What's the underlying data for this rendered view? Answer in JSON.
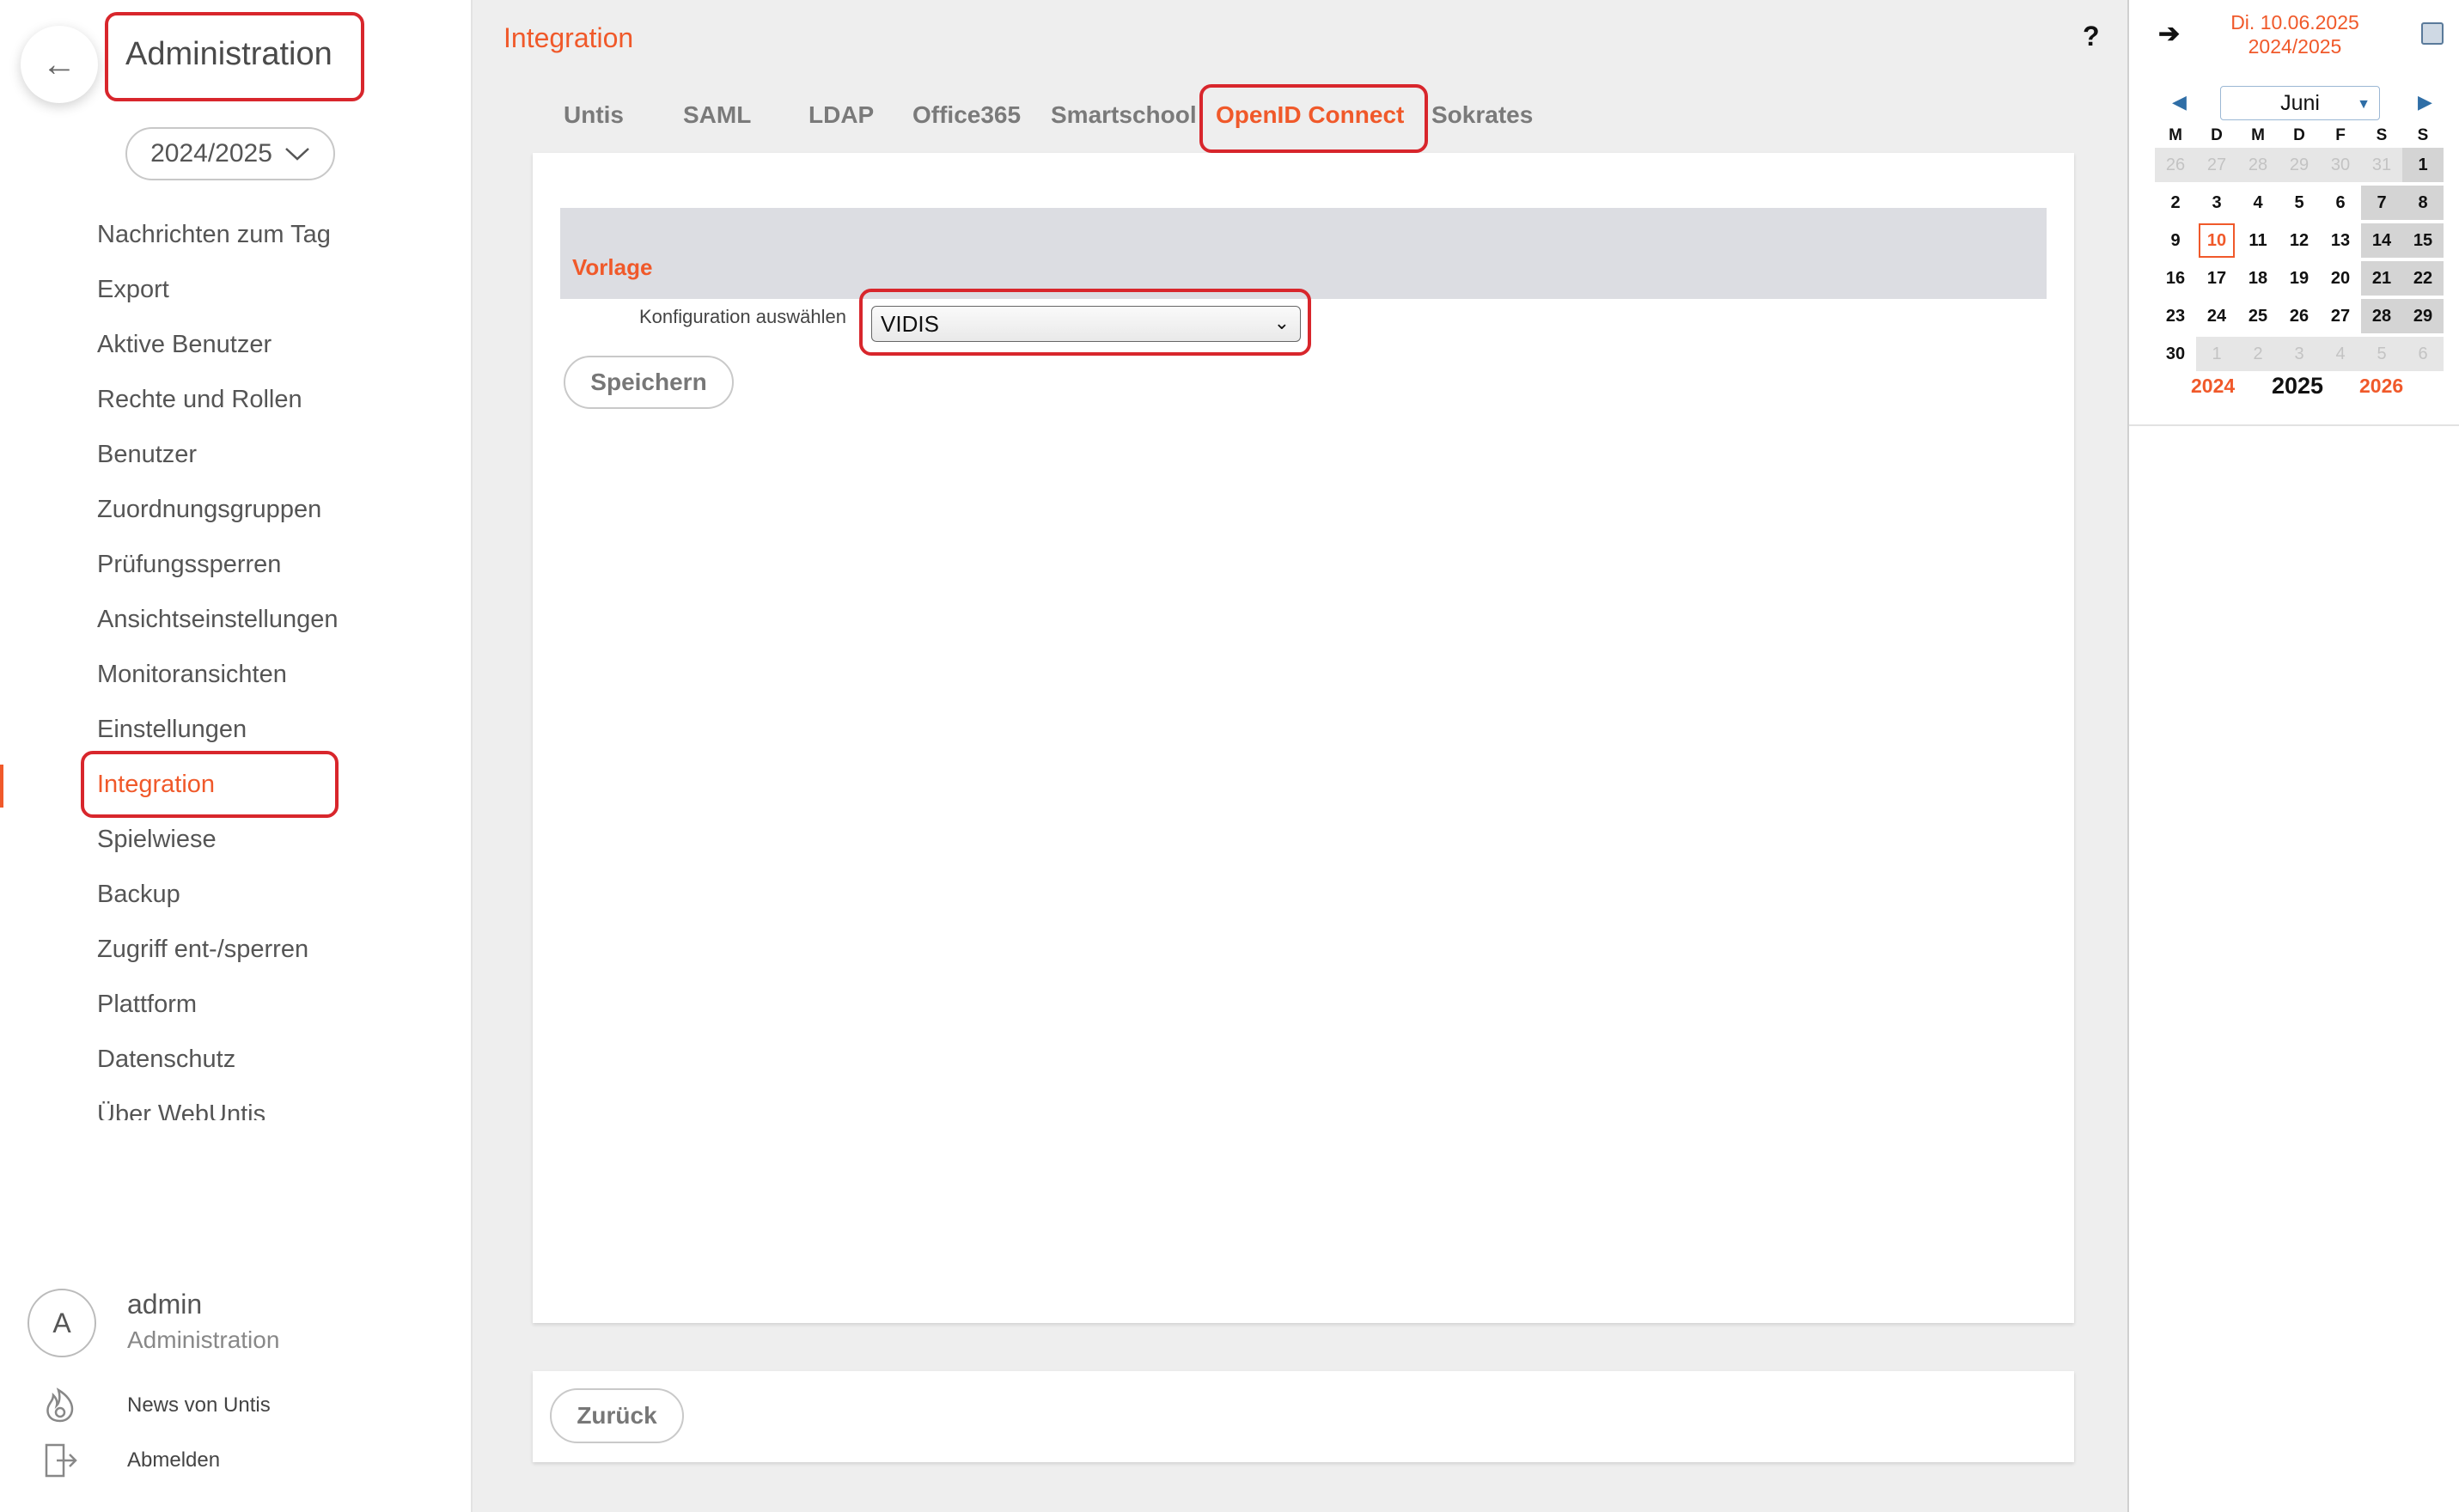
{
  "sidebar": {
    "back_icon": "arrow-left-icon",
    "title": "Administration",
    "school_year": "2024/2025",
    "nav_items": [
      "Nachrichten zum Tag",
      "Export",
      "Aktive Benutzer",
      "Rechte und Rollen",
      "Benutzer",
      "Zuordnungsgruppen",
      "Prüfungssperren",
      "Ansichtseinstellungen",
      "Monitoransichten",
      "Einstellungen",
      "Integration",
      "Spielwiese",
      "Backup",
      "Zugriff ent-/sperren",
      "Plattform",
      "Datenschutz",
      "Über WebUntis"
    ],
    "active_item": "Integration",
    "user": {
      "initial": "A",
      "name": "admin",
      "role": "Administration"
    },
    "footer_links": [
      {
        "label": "News von Untis",
        "icon": "flame-icon"
      },
      {
        "label": "Abmelden",
        "icon": "logout-icon"
      }
    ]
  },
  "main": {
    "title": "Integration",
    "help": "?",
    "tabs": [
      "Untis",
      "SAML",
      "LDAP",
      "Office365",
      "Smartschool",
      "OpenID Connect",
      "Sokrates"
    ],
    "active_tab": "OpenID Connect",
    "section_title": "Vorlage",
    "config_label": "Konfiguration auswählen",
    "config_value": "VIDIS",
    "save_label": "Speichern",
    "back_label": "Zurück"
  },
  "calendar": {
    "date": "Di. 10.06.2025",
    "school_year": "2024/2025",
    "month": "Juni",
    "weekdays": [
      "M",
      "D",
      "M",
      "D",
      "F",
      "S",
      "S"
    ],
    "weeks": [
      [
        "26",
        "27",
        "28",
        "29",
        "30",
        "31",
        "1"
      ],
      [
        "2",
        "3",
        "4",
        "5",
        "6",
        "7",
        "8"
      ],
      [
        "9",
        "10",
        "11",
        "12",
        "13",
        "14",
        "15"
      ],
      [
        "16",
        "17",
        "18",
        "19",
        "20",
        "21",
        "22"
      ],
      [
        "23",
        "24",
        "25",
        "26",
        "27",
        "28",
        "29"
      ],
      [
        "30",
        "1",
        "2",
        "3",
        "4",
        "5",
        "6"
      ]
    ],
    "today": "10",
    "years": {
      "prev": "2024",
      "current": "2025",
      "next": "2026"
    }
  },
  "colors": {
    "accent": "#f0592a",
    "highlight": "#d8262c"
  }
}
